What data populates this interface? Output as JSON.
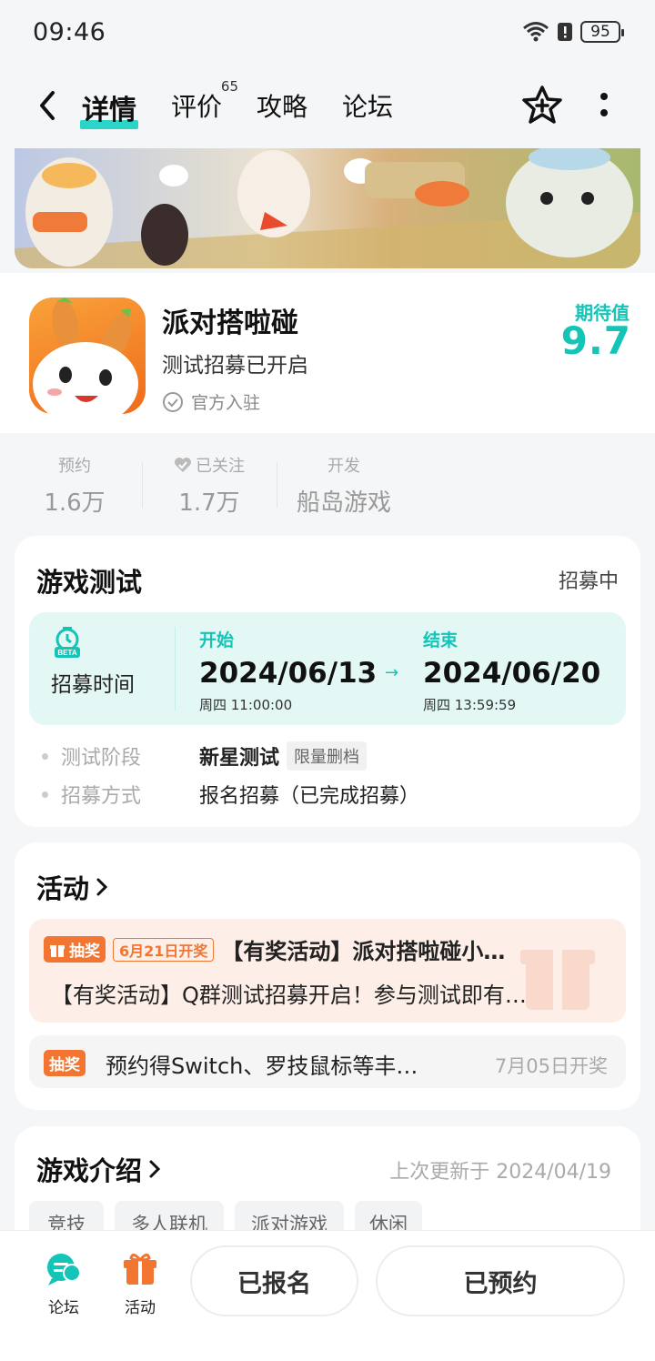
{
  "status": {
    "time": "09:46",
    "battery": "95"
  },
  "nav": {
    "tabs": [
      {
        "label": "详情",
        "active": true
      },
      {
        "label": "评价",
        "badge": "65"
      },
      {
        "label": "攻略"
      },
      {
        "label": "论坛"
      }
    ]
  },
  "game": {
    "title": "派对搭啦碰",
    "subtitle": "测试招募已开启",
    "official": "官方入驻",
    "expect_label": "期待值",
    "expect_score": "9.7"
  },
  "stats": [
    {
      "label": "预约",
      "value": "1.6万"
    },
    {
      "label": "已关注",
      "value": "1.7万"
    },
    {
      "label": "开发",
      "value": "船岛游戏"
    }
  ],
  "test": {
    "title": "游戏测试",
    "status": "招募中",
    "badge": "BETA",
    "recruit_label": "招募时间",
    "start_label": "开始",
    "start_date": "2024/06/13",
    "start_week": "周四  11:00:00",
    "end_label": "结束",
    "end_date": "2024/06/20",
    "end_week": "周四  13:59:59",
    "arrow": "→",
    "stage_key": "测试阶段",
    "stage_val": "新星测试",
    "stage_tag": "限量删档",
    "method_key": "招募方式",
    "method_val": "报名招募（已完成招募）"
  },
  "activity": {
    "title": "活动",
    "item1_badge": "抽奖",
    "item1_date": "6月21日开奖",
    "item1_title": "【有奖活动】派对搭啦碰小…",
    "item1_desc": "【有奖活动】Q群测试招募开启！参与测试即有…",
    "item2_badge": "抽奖",
    "item2_title": "预约得Switch、罗技鼠标等丰…",
    "item2_date": "7月05日开奖"
  },
  "intro": {
    "title": "游戏介绍",
    "updated": "上次更新于 2024/04/19",
    "tags": [
      "竞技",
      "多人联机",
      "派对游戏",
      "休闲"
    ]
  },
  "bottom": {
    "forum": "论坛",
    "activity": "活动",
    "signed": "已报名",
    "reserved": "已预约"
  },
  "colors": {
    "accent": "#14c4b6",
    "orange": "#f27632"
  }
}
